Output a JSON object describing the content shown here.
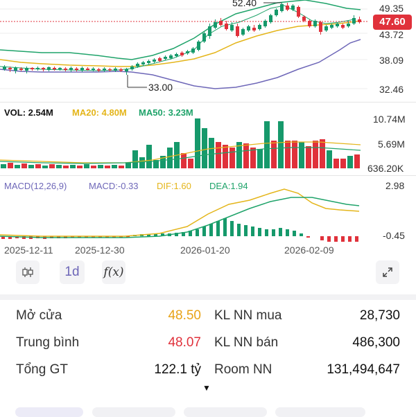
{
  "price_chart": {
    "axis_labels": [
      "49.35",
      "43.72",
      "38.09",
      "32.46"
    ],
    "high_label": "52.40",
    "low_label": "33.00",
    "current_price": "47.60",
    "colors": {
      "up": "#16996b",
      "down": "#e0313b",
      "ma_yellow": "#e4b51a",
      "ma_green": "#1fa36a",
      "band": "#6e67b8"
    }
  },
  "volume_chart": {
    "vol_label": "VOL: 2.54M",
    "ma20_label": "MA20: 4.80M",
    "ma50_label": "MA50: 3.23M",
    "axis_labels": [
      "10.74M",
      "5.69M",
      "636.20K"
    ]
  },
  "macd_chart": {
    "title": "MACD(12,26,9)",
    "macd_label": "MACD:-0.33",
    "dif_label": "DIF:1.60",
    "dea_label": "DEA:1.94",
    "axis_labels": [
      "2.98",
      "-0.45"
    ]
  },
  "dates": [
    "2025-12-11",
    "2025-12-30",
    "2026-01-20",
    "2026-02-09"
  ],
  "toolbar": {
    "interval": "1d",
    "fx": "f(x)"
  },
  "stats": {
    "left": [
      {
        "label": "Mở cửa",
        "value": "48.50",
        "color": "#e8a317"
      },
      {
        "label": "Trung bình",
        "value": "48.07",
        "color": "#e0313b"
      },
      {
        "label": "Tổng GT",
        "value": "122.1 tỷ",
        "color": "#111111"
      }
    ],
    "right": [
      {
        "label": "KL NN mua",
        "value": "28,730"
      },
      {
        "label": "KL NN bán",
        "value": "486,300"
      },
      {
        "label": "Room NN",
        "value": "131,494,647"
      }
    ]
  }
}
